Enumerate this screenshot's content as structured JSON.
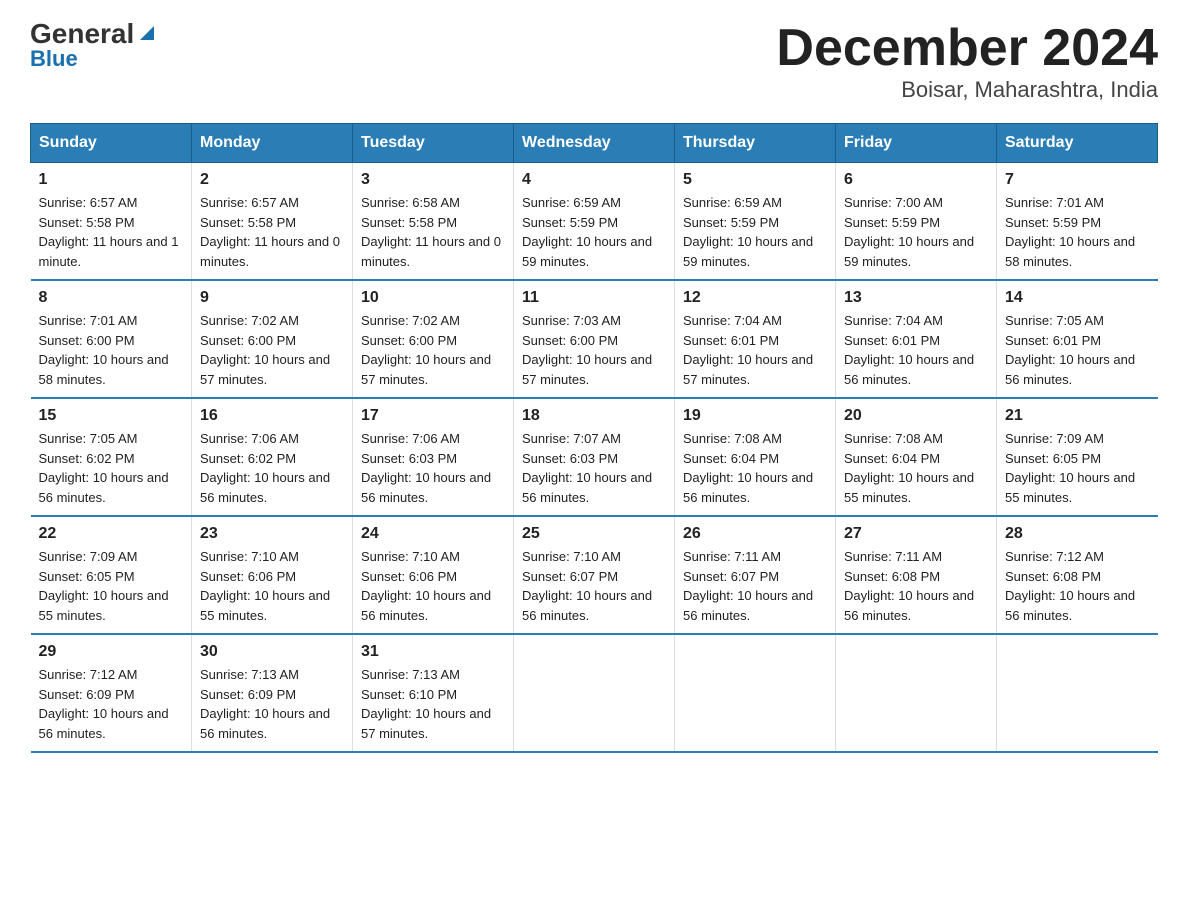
{
  "logo": {
    "general": "General",
    "blue": "Blue",
    "triangle_label": "triangle-decoration"
  },
  "header": {
    "title": "December 2024",
    "subtitle": "Boisar, Maharashtra, India"
  },
  "days_of_week": [
    "Sunday",
    "Monday",
    "Tuesday",
    "Wednesday",
    "Thursday",
    "Friday",
    "Saturday"
  ],
  "weeks": [
    [
      {
        "day": "1",
        "sunrise": "6:57 AM",
        "sunset": "5:58 PM",
        "daylight": "11 hours and 1 minute."
      },
      {
        "day": "2",
        "sunrise": "6:57 AM",
        "sunset": "5:58 PM",
        "daylight": "11 hours and 0 minutes."
      },
      {
        "day": "3",
        "sunrise": "6:58 AM",
        "sunset": "5:58 PM",
        "daylight": "11 hours and 0 minutes."
      },
      {
        "day": "4",
        "sunrise": "6:59 AM",
        "sunset": "5:59 PM",
        "daylight": "10 hours and 59 minutes."
      },
      {
        "day": "5",
        "sunrise": "6:59 AM",
        "sunset": "5:59 PM",
        "daylight": "10 hours and 59 minutes."
      },
      {
        "day": "6",
        "sunrise": "7:00 AM",
        "sunset": "5:59 PM",
        "daylight": "10 hours and 59 minutes."
      },
      {
        "day": "7",
        "sunrise": "7:01 AM",
        "sunset": "5:59 PM",
        "daylight": "10 hours and 58 minutes."
      }
    ],
    [
      {
        "day": "8",
        "sunrise": "7:01 AM",
        "sunset": "6:00 PM",
        "daylight": "10 hours and 58 minutes."
      },
      {
        "day": "9",
        "sunrise": "7:02 AM",
        "sunset": "6:00 PM",
        "daylight": "10 hours and 57 minutes."
      },
      {
        "day": "10",
        "sunrise": "7:02 AM",
        "sunset": "6:00 PM",
        "daylight": "10 hours and 57 minutes."
      },
      {
        "day": "11",
        "sunrise": "7:03 AM",
        "sunset": "6:00 PM",
        "daylight": "10 hours and 57 minutes."
      },
      {
        "day": "12",
        "sunrise": "7:04 AM",
        "sunset": "6:01 PM",
        "daylight": "10 hours and 57 minutes."
      },
      {
        "day": "13",
        "sunrise": "7:04 AM",
        "sunset": "6:01 PM",
        "daylight": "10 hours and 56 minutes."
      },
      {
        "day": "14",
        "sunrise": "7:05 AM",
        "sunset": "6:01 PM",
        "daylight": "10 hours and 56 minutes."
      }
    ],
    [
      {
        "day": "15",
        "sunrise": "7:05 AM",
        "sunset": "6:02 PM",
        "daylight": "10 hours and 56 minutes."
      },
      {
        "day": "16",
        "sunrise": "7:06 AM",
        "sunset": "6:02 PM",
        "daylight": "10 hours and 56 minutes."
      },
      {
        "day": "17",
        "sunrise": "7:06 AM",
        "sunset": "6:03 PM",
        "daylight": "10 hours and 56 minutes."
      },
      {
        "day": "18",
        "sunrise": "7:07 AM",
        "sunset": "6:03 PM",
        "daylight": "10 hours and 56 minutes."
      },
      {
        "day": "19",
        "sunrise": "7:08 AM",
        "sunset": "6:04 PM",
        "daylight": "10 hours and 56 minutes."
      },
      {
        "day": "20",
        "sunrise": "7:08 AM",
        "sunset": "6:04 PM",
        "daylight": "10 hours and 55 minutes."
      },
      {
        "day": "21",
        "sunrise": "7:09 AM",
        "sunset": "6:05 PM",
        "daylight": "10 hours and 55 minutes."
      }
    ],
    [
      {
        "day": "22",
        "sunrise": "7:09 AM",
        "sunset": "6:05 PM",
        "daylight": "10 hours and 55 minutes."
      },
      {
        "day": "23",
        "sunrise": "7:10 AM",
        "sunset": "6:06 PM",
        "daylight": "10 hours and 55 minutes."
      },
      {
        "day": "24",
        "sunrise": "7:10 AM",
        "sunset": "6:06 PM",
        "daylight": "10 hours and 56 minutes."
      },
      {
        "day": "25",
        "sunrise": "7:10 AM",
        "sunset": "6:07 PM",
        "daylight": "10 hours and 56 minutes."
      },
      {
        "day": "26",
        "sunrise": "7:11 AM",
        "sunset": "6:07 PM",
        "daylight": "10 hours and 56 minutes."
      },
      {
        "day": "27",
        "sunrise": "7:11 AM",
        "sunset": "6:08 PM",
        "daylight": "10 hours and 56 minutes."
      },
      {
        "day": "28",
        "sunrise": "7:12 AM",
        "sunset": "6:08 PM",
        "daylight": "10 hours and 56 minutes."
      }
    ],
    [
      {
        "day": "29",
        "sunrise": "7:12 AM",
        "sunset": "6:09 PM",
        "daylight": "10 hours and 56 minutes."
      },
      {
        "day": "30",
        "sunrise": "7:13 AM",
        "sunset": "6:09 PM",
        "daylight": "10 hours and 56 minutes."
      },
      {
        "day": "31",
        "sunrise": "7:13 AM",
        "sunset": "6:10 PM",
        "daylight": "10 hours and 57 minutes."
      },
      null,
      null,
      null,
      null
    ]
  ],
  "labels": {
    "sunrise_prefix": "Sunrise: ",
    "sunset_prefix": "Sunset: ",
    "daylight_prefix": "Daylight: "
  }
}
